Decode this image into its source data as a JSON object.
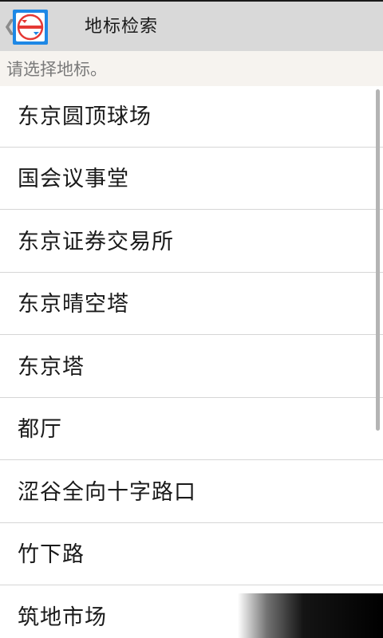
{
  "action_bar": {
    "title": "地标检索",
    "up_glyph": "❮",
    "app_icon": "tokyo-metro-logo-icon"
  },
  "prompt": {
    "text": "请选择地标。"
  },
  "landmarks": [
    "东京圆顶球场",
    "国会议事堂",
    "东京证券交易所",
    "东京晴空塔",
    "东京塔",
    "都厅",
    "涩谷全向十字路口",
    "竹下路",
    "筑地市场"
  ],
  "colors": {
    "action_bar_bg": "#d9d9d9",
    "prompt_bg": "#f6f3ef",
    "app_icon_bg": "#1e88e5",
    "logo_red": "#e53935",
    "divider": "#d6d6d6"
  }
}
